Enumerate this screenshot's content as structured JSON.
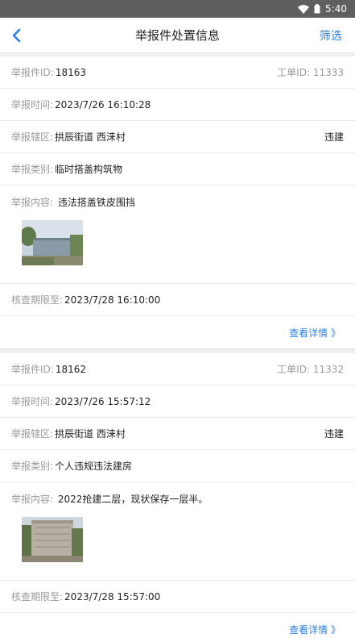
{
  "status_bar": {
    "time": "5:40",
    "wifi_icon": "wifi-icon",
    "battery_icon": "battery-icon"
  },
  "nav": {
    "back_icon": "chevron-left-icon",
    "title": "举报件处置信息",
    "filter_label": "筛选"
  },
  "labels": {
    "report_id": "举报件ID:",
    "work_order_id": "工单ID:",
    "report_time": "举报时间:",
    "district": "举报辖区:",
    "category": "举报类别:",
    "content": "举报内容:",
    "deadline": "核查期限至:",
    "detail": "查看详情 》"
  },
  "reports": [
    {
      "report_id": "18163",
      "work_order_id": "11333",
      "report_time": "2023/7/26 16:10:28",
      "district": "拱辰街道 西涞村",
      "tag": "违建",
      "category": "临时搭盖构筑物",
      "content": "违法搭盖铁皮围挡",
      "deadline": "2023/7/28 16:10:00"
    },
    {
      "report_id": "18162",
      "work_order_id": "11332",
      "report_time": "2023/7/26 15:57:12",
      "district": "拱辰街道 西涞村",
      "tag": "违建",
      "category": "个人违规违法建房",
      "content": "2022抢建二层，现状保存一层半。",
      "deadline": "2023/7/28 15:57:00"
    }
  ],
  "colors": {
    "accent": "#2a7fe0",
    "status_bar": "#5f5f5f",
    "label": "#9a9a9a"
  }
}
